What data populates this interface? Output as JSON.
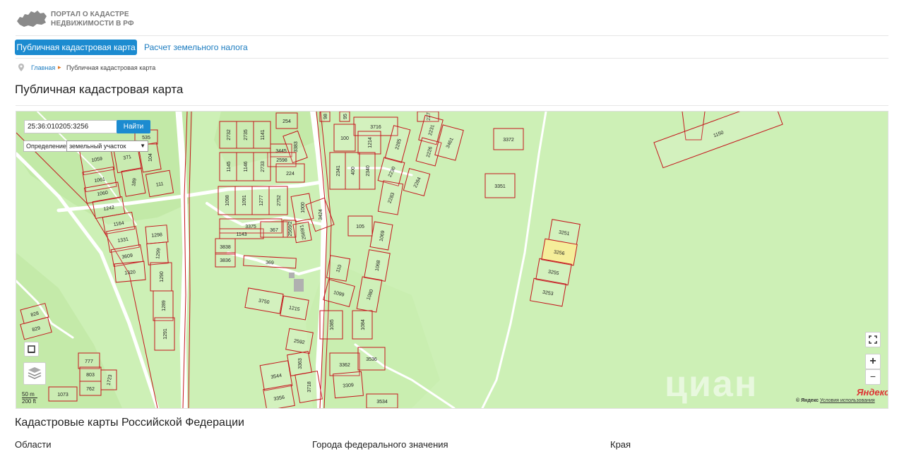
{
  "header": {
    "logo_line1": "ПОРТАЛ О КАДАСТРЕ",
    "logo_line2": "НЕДВИЖИМОСТИ В РФ"
  },
  "tabs": [
    {
      "label": "Публичная кадастровая карта",
      "active": true
    },
    {
      "label": "Расчет земельного налога",
      "active": false
    }
  ],
  "breadcrumb": {
    "home": "Главная",
    "current": "Публичная кадастровая карта"
  },
  "page_title": "Публичная кадастровая карта",
  "map": {
    "search_value": "25:36:010205:3256",
    "search_button": "Найти",
    "definition_label": "Определение:",
    "definition_value": "земельный участок",
    "scale_top": "50 m",
    "scale_bottom": "200 ft",
    "zoom_in": "+",
    "zoom_out": "−",
    "provider": "Яндекс",
    "copyright_provider": "© Яндекс",
    "copyright_terms": "Условия использования",
    "watermark": "циан",
    "colors": {
      "background": "#cdf0b6",
      "parcel_border": "#c4161c",
      "selected_fill": "#f5ee9a",
      "road": "#ffffff",
      "accent": "#1c8bd0"
    },
    "parcels": [
      {
        "label": "254"
      },
      {
        "label": "98"
      },
      {
        "label": "95"
      },
      {
        "label": "3716"
      },
      {
        "label": "227"
      },
      {
        "label": "3372"
      },
      {
        "label": "1150"
      },
      {
        "label": "2732"
      },
      {
        "label": "2735"
      },
      {
        "label": "1141"
      },
      {
        "label": "3445"
      },
      {
        "label": "3383"
      },
      {
        "label": "100"
      },
      {
        "label": "1214"
      },
      {
        "label": "2285"
      },
      {
        "label": "2231"
      },
      {
        "label": "2226"
      },
      {
        "label": "3461"
      },
      {
        "label": "535"
      },
      {
        "label": "371"
      },
      {
        "label": "104"
      },
      {
        "label": "1059"
      },
      {
        "label": "2598"
      },
      {
        "label": "1145"
      },
      {
        "label": "1146"
      },
      {
        "label": "2733"
      },
      {
        "label": "224"
      },
      {
        "label": "2341"
      },
      {
        "label": "400"
      },
      {
        "label": "2340"
      },
      {
        "label": "2230"
      },
      {
        "label": "2284"
      },
      {
        "label": "3351"
      },
      {
        "label": "1061"
      },
      {
        "label": "189"
      },
      {
        "label": "111"
      },
      {
        "label": "1060"
      },
      {
        "label": "1098"
      },
      {
        "label": "1091"
      },
      {
        "label": "1277"
      },
      {
        "label": "2752"
      },
      {
        "label": "1000"
      },
      {
        "label": "3424"
      },
      {
        "label": "2283"
      },
      {
        "label": "1242"
      },
      {
        "label": "1164"
      },
      {
        "label": "3375"
      },
      {
        "label": "1143"
      },
      {
        "label": "367"
      },
      {
        "label": "2569/2"
      },
      {
        "label": "2569/1"
      },
      {
        "label": "105"
      },
      {
        "label": "1069"
      },
      {
        "label": "3251"
      },
      {
        "label": "1298"
      },
      {
        "label": "1331"
      },
      {
        "label": "3838"
      },
      {
        "label": "3256"
      },
      {
        "label": "1299"
      },
      {
        "label": "3609"
      },
      {
        "label": "3836"
      },
      {
        "label": "369"
      },
      {
        "label": "110"
      },
      {
        "label": "1068"
      },
      {
        "label": "3255"
      },
      {
        "label": "1320"
      },
      {
        "label": "1290"
      },
      {
        "label": "1099"
      },
      {
        "label": "1080"
      },
      {
        "label": "3253"
      },
      {
        "label": "3750"
      },
      {
        "label": "1215"
      },
      {
        "label": "1289"
      },
      {
        "label": "828"
      },
      {
        "label": "1085"
      },
      {
        "label": "1084"
      },
      {
        "label": "829"
      },
      {
        "label": "1291"
      },
      {
        "label": "2592"
      },
      {
        "label": "777"
      },
      {
        "label": "3362"
      },
      {
        "label": "3536"
      },
      {
        "label": "3363"
      },
      {
        "label": "803"
      },
      {
        "label": "3544"
      },
      {
        "label": "1723"
      },
      {
        "label": "3718"
      },
      {
        "label": "762"
      },
      {
        "label": "3309"
      },
      {
        "label": "1073"
      },
      {
        "label": "3356"
      },
      {
        "label": "3534"
      }
    ]
  },
  "regions": {
    "title": "Кадастровые карты Российской Федерации",
    "columns": [
      "Области",
      "Города федерального значения",
      "Края"
    ]
  }
}
